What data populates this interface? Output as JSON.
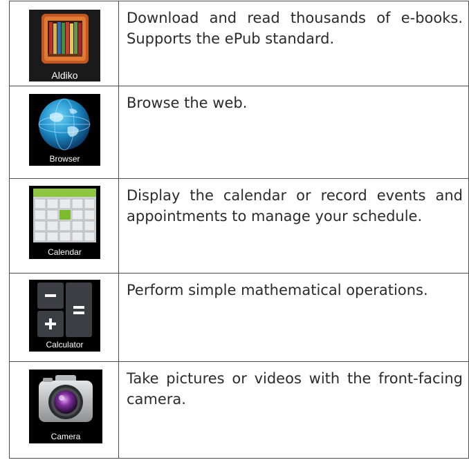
{
  "apps": [
    {
      "label": "Aldiko",
      "icon": "bookshelf-icon",
      "description": "Download and read thousands of e-books. Supports the ePub standard."
    },
    {
      "label": "Browser",
      "icon": "globe-icon",
      "description": "Browse the web."
    },
    {
      "label": "Calendar",
      "icon": "calendar-icon",
      "description": "Display the calendar or record events and appointments to manage your schedule."
    },
    {
      "label": "Calculator",
      "icon": "calculator-icon",
      "description": "Perform simple mathematical operations."
    },
    {
      "label": "Camera",
      "icon": "camera-icon",
      "description": "Take pictures or videos with the front-facing camera."
    }
  ]
}
